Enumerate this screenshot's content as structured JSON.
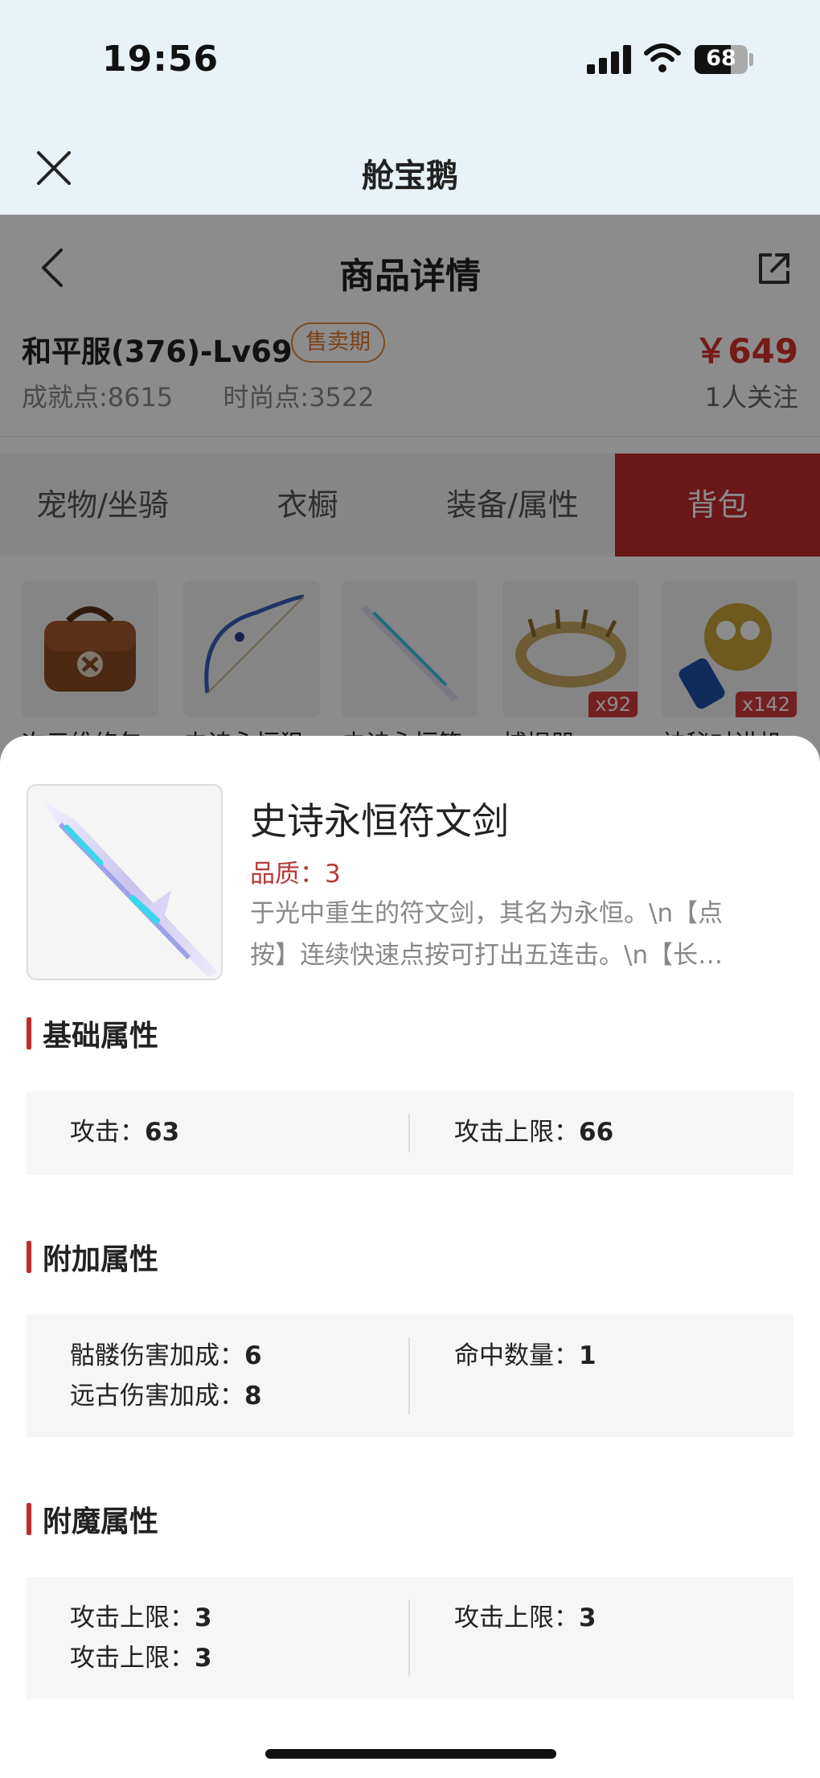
{
  "status_bar": {
    "time": "19:56",
    "battery": "68",
    "battery_level": 0.68
  },
  "mini_program": {
    "title": "舱宝鹅",
    "close_icon": "close-icon"
  },
  "page": {
    "title": "商品详情",
    "back_icon": "chevron-left-icon",
    "share_icon": "share-icon",
    "server": "和平服(376)-Lv69",
    "status_badge": "售卖期",
    "price": "￥649",
    "achievement": "成就点:8615",
    "fashion": "时尚点:3522",
    "followers": "1人关注",
    "tabs": [
      {
        "label": "宠物/坐骑"
      },
      {
        "label": "衣橱"
      },
      {
        "label": "装备/属性"
      },
      {
        "label": "背包"
      }
    ],
    "active_tab": "背包",
    "items": [
      {
        "label": "次元维修包",
        "count": ""
      },
      {
        "label": "史诗永恒狙",
        "count": ""
      },
      {
        "label": "史诗永恒符",
        "count": ""
      },
      {
        "label": "捕捉器",
        "count": "x92"
      },
      {
        "label": "神秘对讲机",
        "count": "x142"
      }
    ]
  },
  "sheet": {
    "item_name": "史诗永恒符文剑",
    "quality": "品质：3",
    "description_line1": "于光中重生的符文剑，其名为永恒。\\n【点",
    "description_line2": "按】连续快速点按可打出五连击。\\n【长…",
    "sections": [
      {
        "title": "基础属性",
        "left": [
          {
            "label": "攻击：",
            "value": "63"
          }
        ],
        "right": [
          {
            "label": "攻击上限：",
            "value": "66"
          }
        ]
      },
      {
        "title": "附加属性",
        "left": [
          {
            "label": "骷髅伤害加成：",
            "value": "6"
          },
          {
            "label": "远古伤害加成：",
            "value": "8"
          }
        ],
        "right": [
          {
            "label": "命中数量：",
            "value": "1"
          }
        ]
      },
      {
        "title": "附魔属性",
        "left": [
          {
            "label": "攻击上限：",
            "value": "3"
          },
          {
            "label": "攻击上限：",
            "value": "3"
          }
        ],
        "right": [
          {
            "label": "攻击上限：",
            "value": "3"
          }
        ]
      }
    ]
  },
  "colors": {
    "accent": "#c22b2b",
    "price": "#d4302c",
    "badge": "#e0782b",
    "header_bg": "#e9f2f6"
  }
}
